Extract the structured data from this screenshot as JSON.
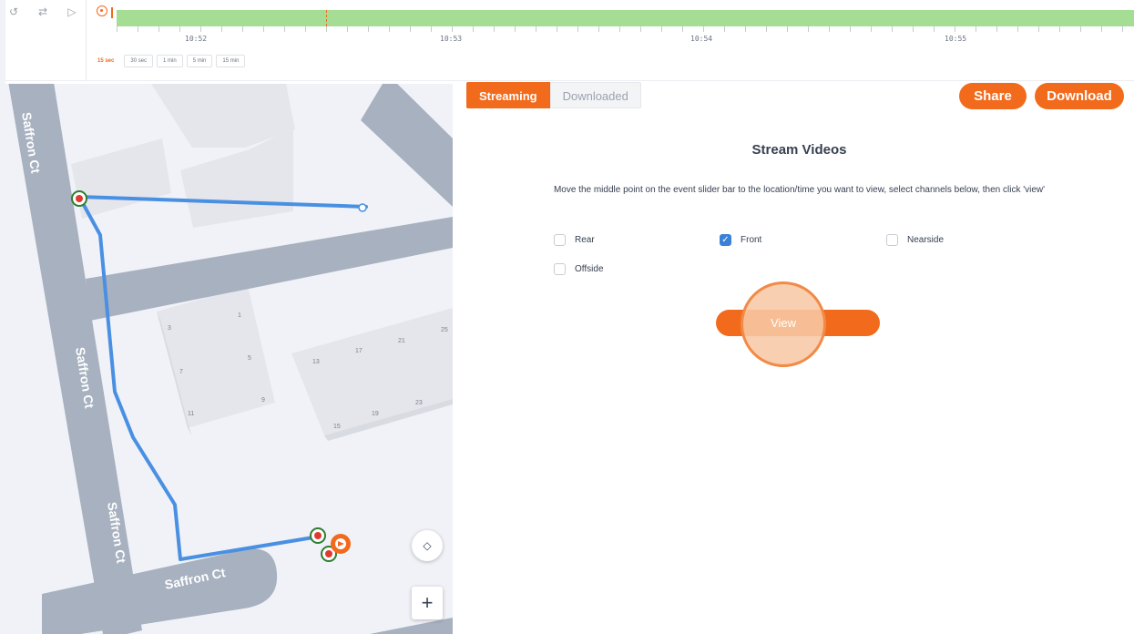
{
  "timeline": {
    "left_icons": [
      "history-icon",
      "sliders-icon",
      "play-icon"
    ],
    "times": [
      "10:52",
      "10:53",
      "10:54",
      "10:55"
    ],
    "zoom_options": [
      "15 sec",
      "30 sec",
      "1 min",
      "5 min",
      "15 min"
    ],
    "active_zoom": "15 sec",
    "bar_color": "#a6dd94"
  },
  "map": {
    "street_labels": [
      "Saffron Ct",
      "Saffron Ct",
      "Saffron Ct",
      "Saffron Ct"
    ],
    "house_numbers": [
      "1",
      "3",
      "5",
      "7",
      "9",
      "11",
      "13",
      "15",
      "17",
      "19",
      "21",
      "23",
      "25"
    ],
    "route_color": "#4a90e2",
    "controls": {
      "recenter_icon": "recenter-icon",
      "zoom_in_label": "+"
    }
  },
  "panel": {
    "tabs": {
      "active": "Streaming",
      "inactive": "Downloaded"
    },
    "share_label": "Share",
    "download_label": "Download",
    "title": "Stream Videos",
    "instructions": "Move the middle point on the event slider bar to the location/time you want to view, select channels below, then click 'view'",
    "channels": [
      {
        "label": "Rear",
        "checked": false
      },
      {
        "label": "Front",
        "checked": true
      },
      {
        "label": "Nearside",
        "checked": false
      },
      {
        "label": "Offside",
        "checked": false
      }
    ],
    "view_label": "View"
  },
  "colors": {
    "accent": "#f26a1b",
    "checkbox": "#3b82d6"
  }
}
